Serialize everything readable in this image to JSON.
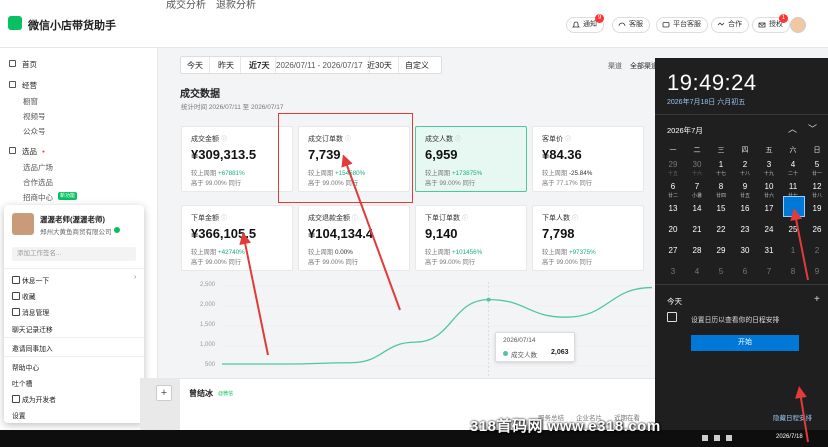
{
  "app": {
    "title": "微信小店带货助手"
  },
  "top_tabs": [
    "成交分析",
    "退款分析"
  ],
  "header_buttons": [
    {
      "label": "通知",
      "icon": "bell-icon",
      "badge": "9"
    },
    {
      "label": "客服",
      "icon": "headset-icon"
    },
    {
      "label": "平台客服",
      "icon": "message-icon"
    },
    {
      "label": "合作",
      "icon": "handshake-icon"
    },
    {
      "label": "授权",
      "icon": "mail-icon",
      "badge": "1"
    }
  ],
  "sidebar": {
    "items": [
      {
        "label": "首页",
        "level": 1,
        "icon": "home-icon"
      },
      {
        "label": "经营",
        "level": 1,
        "icon": "grid-icon"
      },
      {
        "label": "橱窗",
        "level": 2
      },
      {
        "label": "视频号",
        "level": 2
      },
      {
        "label": "公众号",
        "level": 2
      },
      {
        "label": "选品",
        "level": 1,
        "icon": "box-icon"
      },
      {
        "label": "选品广场",
        "level": 2
      },
      {
        "label": "合作选品",
        "level": 2
      },
      {
        "label": "招商中心",
        "level": 2,
        "tag": "新功能"
      }
    ]
  },
  "popup": {
    "name": "渥渥老师(渥渥老师)",
    "company": "郑州大黄鱼商贸有限公司",
    "tag_placeholder": "添加工作签名...",
    "items": [
      {
        "label": "休息一下",
        "icon": "rest-icon",
        "arrow": "›"
      },
      {
        "label": "收藏",
        "icon": "star-icon"
      },
      {
        "label": "消息管理",
        "icon": "message-icon"
      },
      {
        "label": "聊天记录迁移"
      },
      {
        "label": "邀请同事加入"
      },
      {
        "label": "帮助中心"
      },
      {
        "label": "吐个槽"
      },
      {
        "label": "成为开发者",
        "icon": "code-icon"
      },
      {
        "label": "设置"
      }
    ]
  },
  "filter": {
    "options": [
      "今天",
      "昨天",
      "近7天",
      "2026/07/11 - 2026/07/17",
      "近30天",
      "自定义"
    ],
    "active": "近7天",
    "channel_label": "渠道",
    "channel_value": "全部渠道"
  },
  "section": {
    "title": "成交数据",
    "time": "统计时间 2026/07/11 至 2026/07/17"
  },
  "cards": [
    {
      "label": "成交金额",
      "value": "¥309,313.5",
      "cmp_label": "较上周期",
      "cmp": "+67881%",
      "rank": "高于 99.00% 同行"
    },
    {
      "label": "成交订单数",
      "value": "7,739",
      "cmp_label": "较上周期",
      "cmp": "+154580%",
      "rank": "高于 99.00% 同行"
    },
    {
      "label": "成交人数",
      "value": "6,959",
      "cmp_label": "较上周期",
      "cmp": "+173875%",
      "rank": "高于 99.00% 同行",
      "selected": true
    },
    {
      "label": "客单价",
      "value": "¥84.36",
      "cmp_label": "较上周期",
      "cmp": "-25.84%",
      "rank": "高于 77.17% 同行",
      "down": true
    },
    {
      "label": "下单金额",
      "value": "¥366,105.5",
      "cmp_label": "较上周期",
      "cmp": "+42740%",
      "rank": "高于 99.00% 同行"
    },
    {
      "label": "成交退款金额",
      "value": "¥104,134.4",
      "cmp_label": "较上周期",
      "cmp": "0.00%",
      "rank": "高于 99.00% 同行",
      "down": true
    },
    {
      "label": "下单订单数",
      "value": "9,140",
      "cmp_label": "较上周期",
      "cmp": "+101456%",
      "rank": "高于 99.00% 同行"
    },
    {
      "label": "下单人数",
      "value": "7,798",
      "cmp_label": "较上周期",
      "cmp": "+97375%",
      "rank": "高于 99.00% 同行"
    }
  ],
  "chart_data": {
    "type": "line",
    "yticks": [
      "2,500",
      "2,000",
      "1,500",
      "1,000",
      "500"
    ],
    "ylim": [
      0,
      2500
    ],
    "series": [
      {
        "name": "成交人数",
        "color": "#51c5a3",
        "points": [
          [
            0,
            0
          ],
          [
            0.15,
            0
          ],
          [
            0.3,
            40
          ],
          [
            0.45,
            700
          ],
          [
            0.62,
            2063
          ],
          [
            0.8,
            1500
          ],
          [
            1.0,
            2450
          ]
        ]
      }
    ],
    "tooltip": {
      "date": "2026/07/14",
      "series": "成交人数",
      "value": "2,063"
    }
  },
  "bottom": {
    "name": "曾结冰",
    "tag": "@微信",
    "tabs": [
      "服务总结",
      "企业名片",
      "近期在看"
    ]
  },
  "calendar": {
    "time": "19:49:24",
    "date": "2026年7月18日 六月初五",
    "month": "2026年7月",
    "weekdays": [
      "一",
      "二",
      "三",
      "四",
      "五",
      "六",
      "日"
    ],
    "rows": [
      [
        [
          "29",
          "十五",
          1
        ],
        [
          "30",
          "十六",
          1
        ],
        [
          "1",
          "十七",
          0
        ],
        [
          "2",
          "十八",
          0
        ],
        [
          "3",
          "十九",
          0
        ],
        [
          "4",
          "二十",
          0
        ],
        [
          "5",
          "廿一",
          0
        ]
      ],
      [
        [
          "6",
          "廿二",
          0
        ],
        [
          "7",
          "小暑",
          0
        ],
        [
          "8",
          "廿四",
          0
        ],
        [
          "9",
          "廿五",
          0
        ],
        [
          "10",
          "廿六",
          0
        ],
        [
          "11",
          "廿七",
          0
        ],
        [
          "12",
          "廿八",
          0
        ]
      ],
      [
        [
          "13",
          "",
          0
        ],
        [
          "14",
          "",
          0
        ],
        [
          "15",
          "",
          0
        ],
        [
          "16",
          "",
          0
        ],
        [
          "17",
          "",
          0
        ],
        [
          "18",
          "",
          0
        ],
        [
          "19",
          "",
          0
        ]
      ],
      [
        [
          "20",
          "",
          0
        ],
        [
          "21",
          "",
          0
        ],
        [
          "22",
          "",
          0
        ],
        [
          "23",
          "",
          0
        ],
        [
          "24",
          "",
          0
        ],
        [
          "25",
          "",
          0
        ],
        [
          "26",
          "",
          0
        ]
      ],
      [
        [
          "27",
          "",
          0
        ],
        [
          "28",
          "",
          0
        ],
        [
          "29",
          "",
          0
        ],
        [
          "30",
          "",
          0
        ],
        [
          "31",
          "",
          0
        ],
        [
          "1",
          "",
          1
        ],
        [
          "2",
          "",
          1
        ]
      ],
      [
        [
          "3",
          "",
          1
        ],
        [
          "4",
          "",
          1
        ],
        [
          "5",
          "",
          1
        ],
        [
          "6",
          "",
          1
        ],
        [
          "7",
          "",
          1
        ],
        [
          "8",
          "",
          1
        ],
        [
          "9",
          "",
          1
        ]
      ]
    ],
    "today": "18",
    "today_label": "今天",
    "schedule_text": "设置日历以查看你的日程安排",
    "start_button": "开始",
    "hide_label": "隐藏日程安排"
  },
  "taskbar": {
    "date": "2026/7/18"
  },
  "watermark": "318首码网 www.e318.com",
  "colors": {
    "accent": "#07c160",
    "chart": "#51c5a3",
    "annotation": "#e23b3b",
    "windows_blue": "#0078d7"
  }
}
